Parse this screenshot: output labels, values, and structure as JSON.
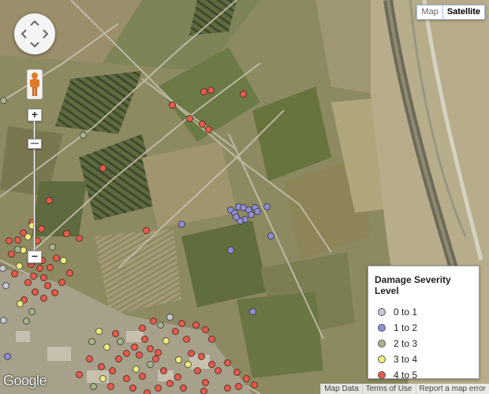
{
  "map_type": {
    "map_label": "Map",
    "satellite_label": "Satellite",
    "selected": "Satellite"
  },
  "controls": {
    "pan_icon": "pan-arrows-icon",
    "pegman_icon": "street-view-pegman-icon",
    "zoom_in": "+",
    "zoom_out": "−",
    "zoom_level_fraction": 0.15
  },
  "legend": {
    "title": "Damage Severity Level",
    "items": [
      {
        "label": "0 to 1",
        "color": "#c8c8d6"
      },
      {
        "label": "1 to 2",
        "color": "#8f8fd4"
      },
      {
        "label": "2 to 3",
        "color": "#a8b48a"
      },
      {
        "label": "3 to 4",
        "color": "#f0ec80"
      },
      {
        "label": "4 to 5",
        "color": "#e85a4a"
      }
    ]
  },
  "branding": {
    "logo_text": "Google"
  },
  "footer": {
    "map_data": "Map Data",
    "terms": "Terms of Use",
    "report": "Report a map error"
  }
}
